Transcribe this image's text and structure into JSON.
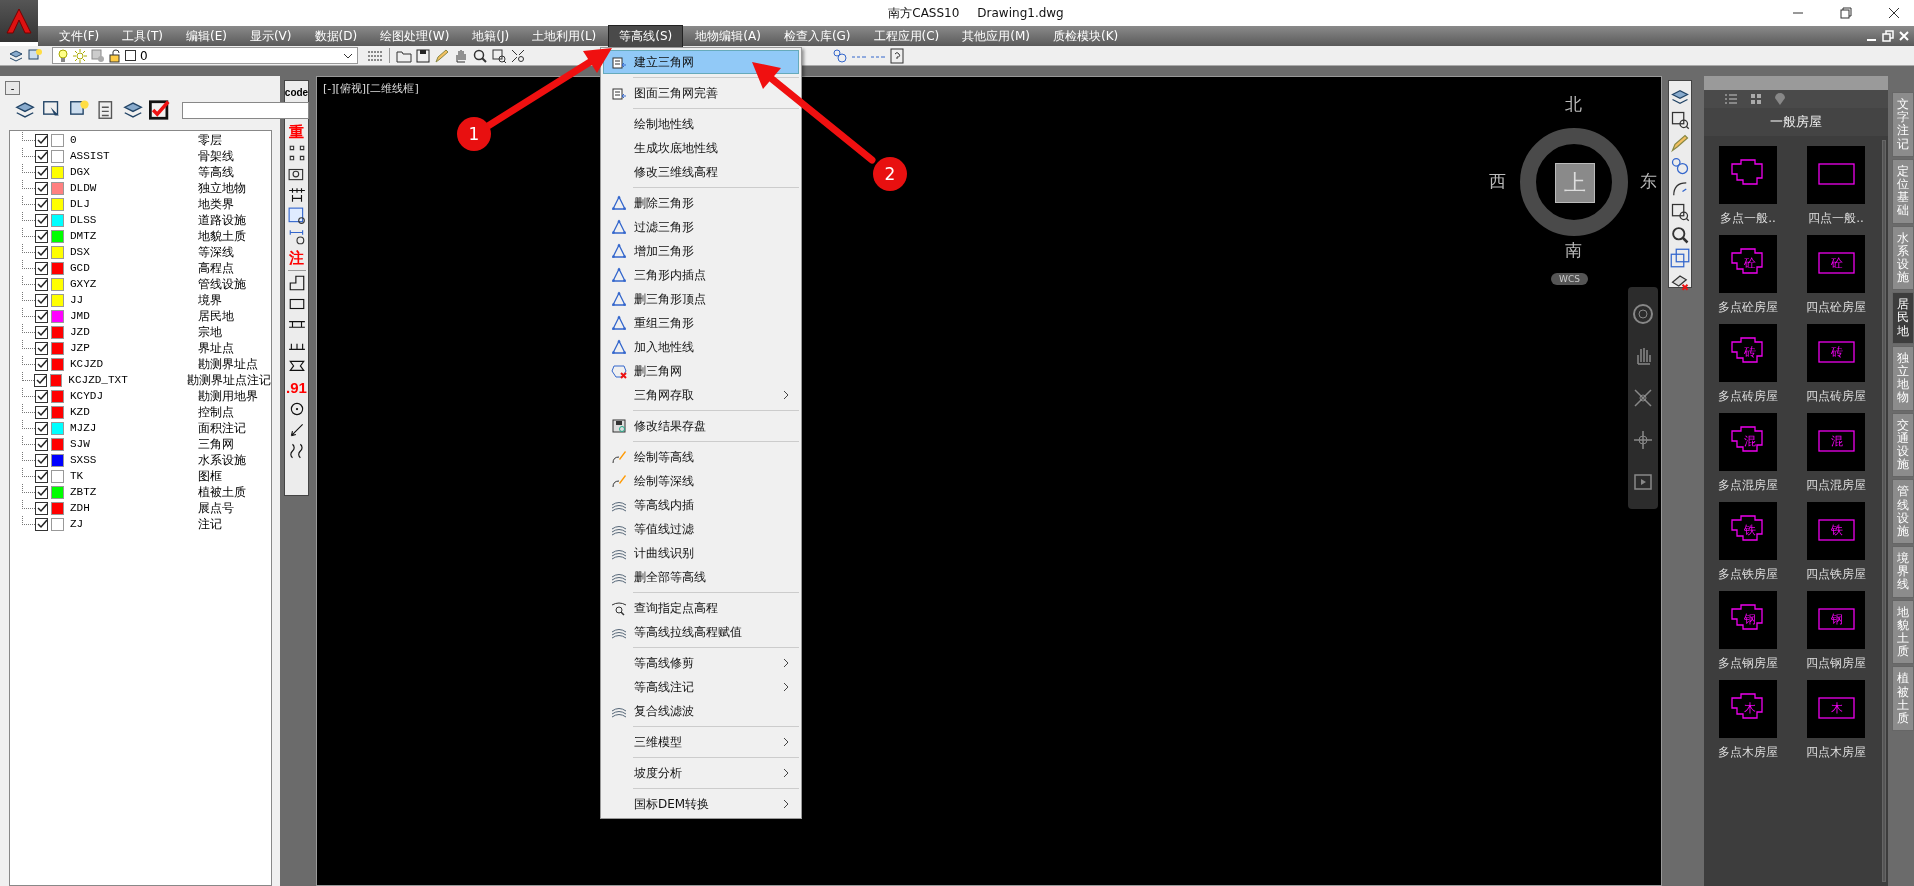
{
  "window": {
    "app_title": "南方CASS10",
    "file_title": "Drawing1.dwg"
  },
  "menu_bar": [
    {
      "label": "文件(F)",
      "selected": false
    },
    {
      "label": "工具(T)",
      "selected": false
    },
    {
      "label": "编辑(E)",
      "selected": false
    },
    {
      "label": "显示(V)",
      "selected": false
    },
    {
      "label": "数据(D)",
      "selected": false
    },
    {
      "label": "绘图处理(W)",
      "selected": false
    },
    {
      "label": "地籍(J)",
      "selected": false
    },
    {
      "label": "土地利用(L)",
      "selected": false
    },
    {
      "label": "等高线(S)",
      "selected": true
    },
    {
      "label": "地物编辑(A)",
      "selected": false
    },
    {
      "label": "检查入库(G)",
      "selected": false
    },
    {
      "label": "工程应用(C)",
      "selected": false
    },
    {
      "label": "其他应用(M)",
      "selected": false
    },
    {
      "label": "质检模块(K)",
      "selected": false
    }
  ],
  "toolbar": {
    "layer_dropdown": {
      "value": "0"
    }
  },
  "layer_panel": {
    "collapse_button": "-",
    "layers": [
      {
        "name": "0",
        "description": "零层",
        "checked": true,
        "color": "#ffffff"
      },
      {
        "name": "ASSIST",
        "description": "骨架线",
        "checked": true,
        "color": "#ffffff"
      },
      {
        "name": "DGX",
        "description": "等高线",
        "checked": true,
        "color": "#ffff00"
      },
      {
        "name": "DLDW",
        "description": "独立地物",
        "checked": true,
        "color": "#ff8080"
      },
      {
        "name": "DLJ",
        "description": "地类界",
        "checked": true,
        "color": "#ffff00"
      },
      {
        "name": "DLSS",
        "description": "道路设施",
        "checked": true,
        "color": "#00ffff"
      },
      {
        "name": "DMTZ",
        "description": "地貌土质",
        "checked": true,
        "color": "#00ff00"
      },
      {
        "name": "DSX",
        "description": "等深线",
        "checked": true,
        "color": "#ffff00"
      },
      {
        "name": "GCD",
        "description": "高程点",
        "checked": true,
        "color": "#ff0000"
      },
      {
        "name": "GXYZ",
        "description": "管线设施",
        "checked": true,
        "color": "#ffff00"
      },
      {
        "name": "JJ",
        "description": "境界",
        "checked": true,
        "color": "#ffff00"
      },
      {
        "name": "JMD",
        "description": "居民地",
        "checked": true,
        "color": "#ff00ff"
      },
      {
        "name": "JZD",
        "description": "宗地",
        "checked": true,
        "color": "#ff0000"
      },
      {
        "name": "JZP",
        "description": "界址点",
        "checked": true,
        "color": "#ff0000"
      },
      {
        "name": "KCJZD",
        "description": "勘测界址点",
        "checked": true,
        "color": "#ff0000"
      },
      {
        "name": "KCJZD_TXT",
        "description": "勘测界址点注记",
        "checked": true,
        "color": "#ff0000"
      },
      {
        "name": "KCYDJ",
        "description": "勘测用地界",
        "checked": true,
        "color": "#ff0000"
      },
      {
        "name": "KZD",
        "description": "控制点",
        "checked": true,
        "color": "#ff0000"
      },
      {
        "name": "MJZJ",
        "description": "面积注记",
        "checked": true,
        "color": "#00ffff"
      },
      {
        "name": "SJW",
        "description": "三角网",
        "checked": true,
        "color": "#ff0000"
      },
      {
        "name": "SXSS",
        "description": "水系设施",
        "checked": true,
        "color": "#0000ff"
      },
      {
        "name": "TK",
        "description": "图框",
        "checked": true,
        "color": "#ffffff"
      },
      {
        "name": "ZBTZ",
        "description": "植被土质",
        "checked": true,
        "color": "#00ff00"
      },
      {
        "name": "ZDH",
        "description": "展点号",
        "checked": true,
        "color": "#ff0000"
      },
      {
        "name": "ZJ",
        "description": "注记",
        "checked": true,
        "color": "#ffffff"
      }
    ]
  },
  "left_toolbar": [
    {
      "kind": "text",
      "label": "code",
      "color": "#000000"
    },
    {
      "kind": "icon"
    },
    {
      "kind": "text",
      "label": "重",
      "color": "#ff0000"
    },
    {
      "kind": "icon"
    },
    {
      "kind": "icon"
    },
    {
      "kind": "icon"
    },
    {
      "kind": "icon"
    },
    {
      "kind": "icon"
    },
    {
      "kind": "text",
      "label": "注",
      "color": "#ff0000"
    },
    {
      "kind": "separator"
    },
    {
      "kind": "icon"
    },
    {
      "kind": "icon"
    },
    {
      "kind": "icon"
    },
    {
      "kind": "icon"
    },
    {
      "kind": "icon"
    },
    {
      "kind": "text",
      "label": ".91",
      "color": "#ff0000"
    },
    {
      "kind": "icon"
    },
    {
      "kind": "icon"
    },
    {
      "kind": "icon"
    }
  ],
  "canvas": {
    "viewport_label": "[-][俯视][二维线框]",
    "viewcube": {
      "north": "北",
      "south": "南",
      "west": "西",
      "east": "东",
      "top": "上",
      "coordinate_system": "WCS"
    }
  },
  "dropdown_menu": [
    {
      "kind": "item",
      "label": "建立三角网",
      "selected": true,
      "icon": true,
      "submenu": false
    },
    {
      "kind": "separator"
    },
    {
      "kind": "item",
      "label": "图面三角网完善",
      "selected": false,
      "icon": true,
      "submenu": false
    },
    {
      "kind": "separator"
    },
    {
      "kind": "item",
      "label": "绘制地性线",
      "selected": false,
      "icon": false,
      "submenu": false
    },
    {
      "kind": "item",
      "label": "生成坎底地性线",
      "selected": false,
      "icon": false,
      "submenu": false
    },
    {
      "kind": "item",
      "label": "修改三维线高程",
      "selected": false,
      "icon": false,
      "submenu": false
    },
    {
      "kind": "separator"
    },
    {
      "kind": "item",
      "label": "删除三角形",
      "selected": false,
      "icon": true,
      "submenu": false
    },
    {
      "kind": "item",
      "label": "过滤三角形",
      "selected": false,
      "icon": true,
      "submenu": false
    },
    {
      "kind": "item",
      "label": "增加三角形",
      "selected": false,
      "icon": true,
      "submenu": false
    },
    {
      "kind": "item",
      "label": "三角形内插点",
      "selected": false,
      "icon": true,
      "submenu": false
    },
    {
      "kind": "item",
      "label": "删三角形顶点",
      "selected": false,
      "icon": true,
      "submenu": false
    },
    {
      "kind": "item",
      "label": "重组三角形",
      "selected": false,
      "icon": true,
      "submenu": false
    },
    {
      "kind": "item",
      "label": "加入地性线",
      "selected": false,
      "icon": true,
      "submenu": false
    },
    {
      "kind": "item",
      "label": "删三角网",
      "selected": false,
      "icon": true,
      "submenu": false
    },
    {
      "kind": "item",
      "label": "三角网存取",
      "selected": false,
      "icon": false,
      "submenu": true
    },
    {
      "kind": "separator"
    },
    {
      "kind": "item",
      "label": "修改结果存盘",
      "selected": false,
      "icon": true,
      "submenu": false
    },
    {
      "kind": "separator"
    },
    {
      "kind": "item",
      "label": "绘制等高线",
      "selected": false,
      "icon": true,
      "submenu": false
    },
    {
      "kind": "item",
      "label": "绘制等深线",
      "selected": false,
      "icon": true,
      "submenu": false
    },
    {
      "kind": "item",
      "label": "等高线内插",
      "selected": false,
      "icon": true,
      "submenu": false
    },
    {
      "kind": "item",
      "label": "等值线过滤",
      "selected": false,
      "icon": true,
      "submenu": false
    },
    {
      "kind": "item",
      "label": "计曲线识别",
      "selected": false,
      "icon": true,
      "submenu": false
    },
    {
      "kind": "item",
      "label": "删全部等高线",
      "selected": false,
      "icon": true,
      "submenu": false
    },
    {
      "kind": "separator"
    },
    {
      "kind": "item",
      "label": "查询指定点高程",
      "selected": false,
      "icon": true,
      "submenu": false
    },
    {
      "kind": "item",
      "label": "等高线拉线高程赋值",
      "selected": false,
      "icon": true,
      "submenu": false
    },
    {
      "kind": "separator"
    },
    {
      "kind": "item",
      "label": "等高线修剪",
      "selected": false,
      "icon": false,
      "submenu": true
    },
    {
      "kind": "item",
      "label": "等高线注记",
      "selected": false,
      "icon": false,
      "submenu": true
    },
    {
      "kind": "item",
      "label": "复合线滤波",
      "selected": false,
      "icon": true,
      "submenu": false
    },
    {
      "kind": "separator"
    },
    {
      "kind": "item",
      "label": "三维模型",
      "selected": false,
      "icon": false,
      "submenu": true
    },
    {
      "kind": "separator"
    },
    {
      "kind": "item",
      "label": "坡度分析",
      "selected": false,
      "icon": false,
      "submenu": true
    },
    {
      "kind": "separator"
    },
    {
      "kind": "item",
      "label": "国标DEM转换",
      "selected": false,
      "icon": false,
      "submenu": true
    }
  ],
  "tool_palette": {
    "title": "一般房屋",
    "tiles": [
      {
        "kind": "multipoint",
        "label": "多点一般.."
      },
      {
        "kind": "fourpoint",
        "label": "四点一般.."
      },
      {
        "kind": "multipoint",
        "label": "多点砼房屋",
        "glyph": "砼"
      },
      {
        "kind": "fourpoint",
        "label": "四点砼房屋",
        "glyph": "砼"
      },
      {
        "kind": "multipoint",
        "label": "多点砖房屋",
        "glyph": "砖"
      },
      {
        "kind": "fourpoint",
        "label": "四点砖房屋",
        "glyph": "砖"
      },
      {
        "kind": "multipoint",
        "label": "多点混房屋",
        "glyph": "混"
      },
      {
        "kind": "fourpoint",
        "label": "四点混房屋",
        "glyph": "混"
      },
      {
        "kind": "multipoint",
        "label": "多点铁房屋",
        "glyph": "铁"
      },
      {
        "kind": "fourpoint",
        "label": "四点铁房屋",
        "glyph": "铁"
      },
      {
        "kind": "multipoint",
        "label": "多点钢房屋",
        "glyph": "钢"
      },
      {
        "kind": "fourpoint",
        "label": "四点钢房屋",
        "glyph": "钢"
      },
      {
        "kind": "multipoint",
        "label": "多点木房屋",
        "glyph": "木"
      },
      {
        "kind": "fourpoint",
        "label": "四点木房屋",
        "glyph": "木"
      }
    ]
  },
  "side_tabs": [
    {
      "label": "文字注记",
      "selected": false
    },
    {
      "label": "定位基础",
      "selected": false
    },
    {
      "label": "水系设施",
      "selected": false
    },
    {
      "label": "居民地",
      "selected": true
    },
    {
      "label": "独立地物",
      "selected": false
    },
    {
      "label": "交通设施",
      "selected": false
    },
    {
      "label": "管线设施",
      "selected": false
    },
    {
      "label": "境界线",
      "selected": false
    },
    {
      "label": "地貌土质",
      "selected": false
    },
    {
      "label": "植被土质",
      "selected": false
    }
  ],
  "annotations": [
    {
      "number": "1"
    },
    {
      "number": "2"
    }
  ]
}
